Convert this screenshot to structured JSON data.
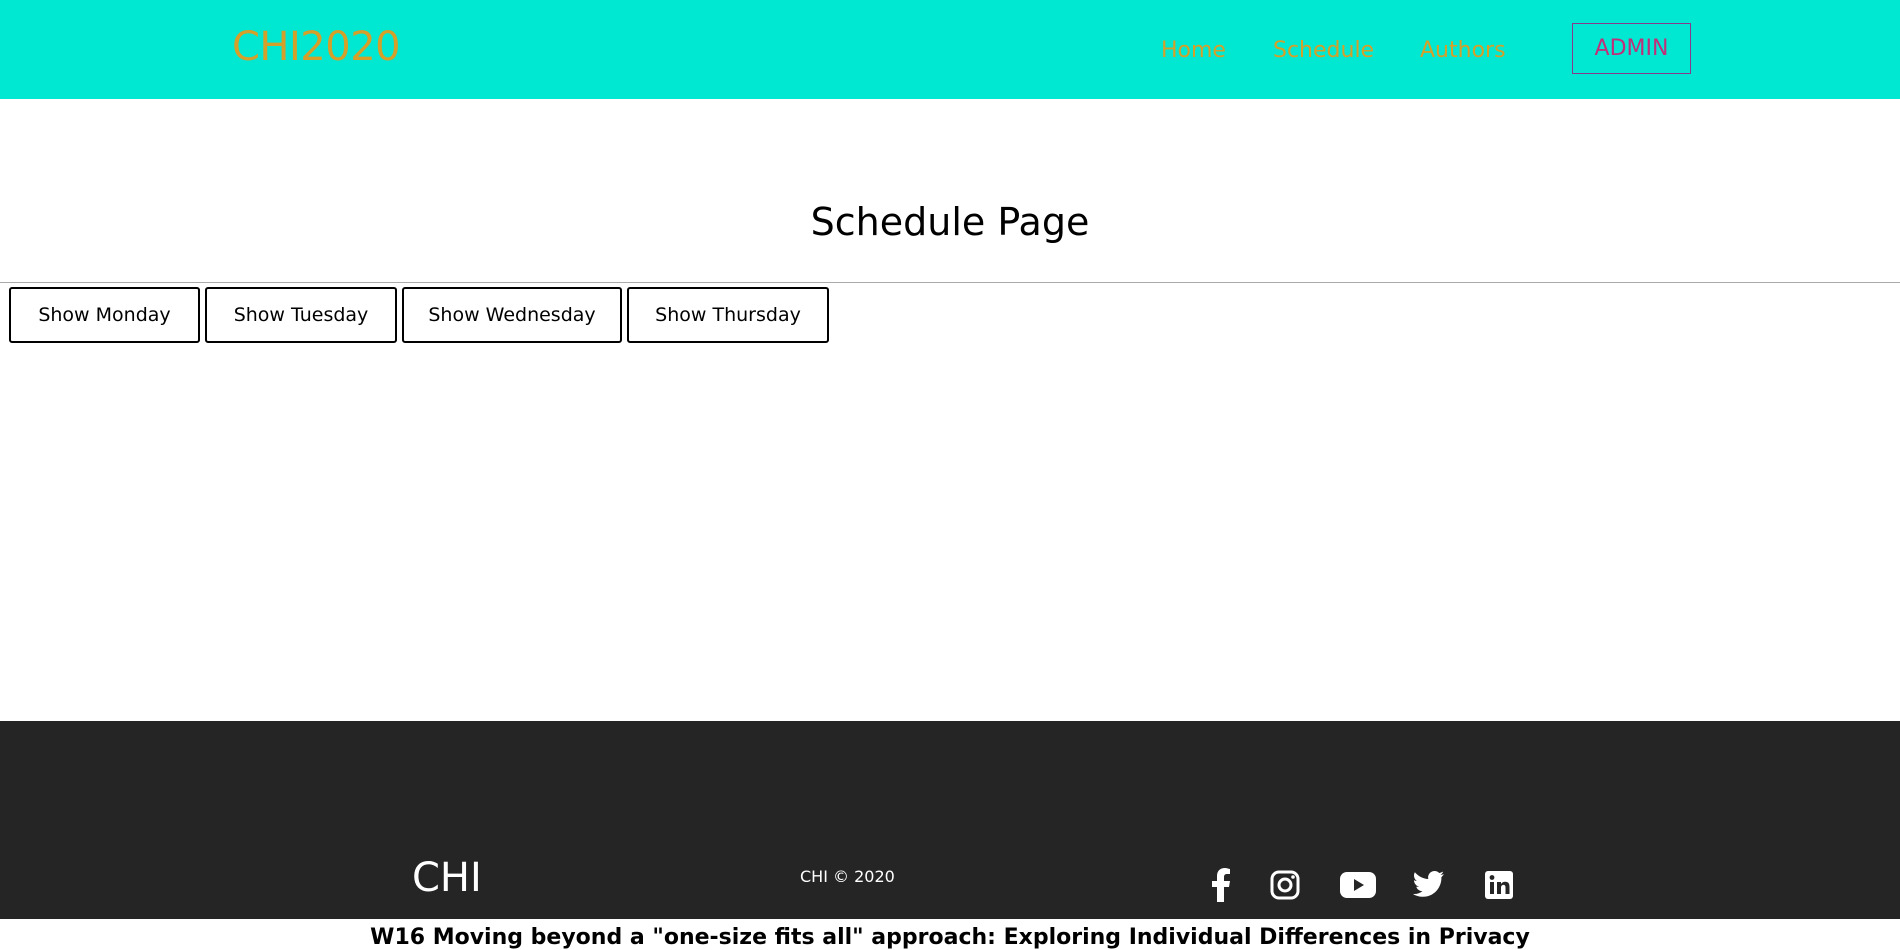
{
  "header": {
    "brand": "CHI2020",
    "nav": [
      "Home",
      "Schedule",
      "Authors"
    ],
    "admin_label": "ADMIN"
  },
  "main": {
    "title": "Schedule Page",
    "day_buttons": [
      "Show Monday",
      "Show Tuesday",
      "Show Wednesday",
      "Show Thursday"
    ],
    "overflow_text": "W16 Moving beyond a \"one-size fits all\" approach: Exploring Individual Differences in Privacy"
  },
  "footer": {
    "logo": "CHI",
    "copyright": "CHI © 2020",
    "social_icons": [
      "facebook-icon",
      "instagram-icon",
      "youtube-icon",
      "twitter-icon",
      "linkedin-icon"
    ]
  },
  "colors": {
    "header_bg": "#00e8d2",
    "brand": "#d4a02a",
    "admin": "#c0307a",
    "footer_bg": "#252525"
  }
}
